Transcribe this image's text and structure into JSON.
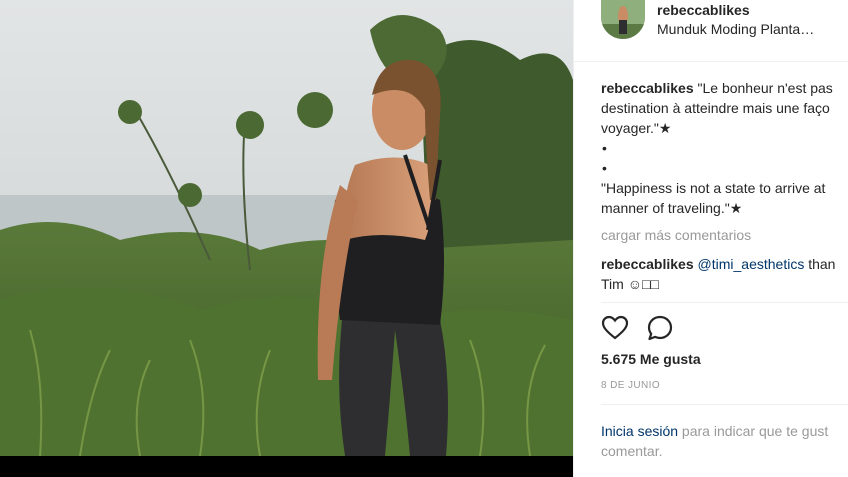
{
  "post": {
    "author": "rebeccablikes",
    "location": "Munduk Moding Planta…"
  },
  "caption": {
    "username": "rebeccablikes",
    "line1": " \"Le bonheur n'est pas",
    "line2": "destination à atteindre mais une faço",
    "line3": "voyager.\"",
    "star_1": "★",
    "bullet": "•",
    "line4": "\"Happiness is not a state to arrive at",
    "line5": "manner of traveling.\"",
    "star_2": "★"
  },
  "comments": {
    "load_more": "cargar más comentarios",
    "items": [
      {
        "username": "rebeccablikes",
        "mention": "@timi_aesthetics",
        "text_after": " than",
        "line2": "Tim ☺︎□□"
      }
    ]
  },
  "actions": {
    "like_icon": "heart-outline-icon",
    "comment_icon": "speech-bubble-icon"
  },
  "likes_text": "5.675 Me gusta",
  "date_text": "8 DE JUNIO",
  "login": {
    "link": "Inicia sesión",
    "text_line1": " para indicar que te gust",
    "text_line2": "comentar."
  },
  "colors": {
    "link": "#003569",
    "muted": "#999999",
    "text": "#262626"
  }
}
